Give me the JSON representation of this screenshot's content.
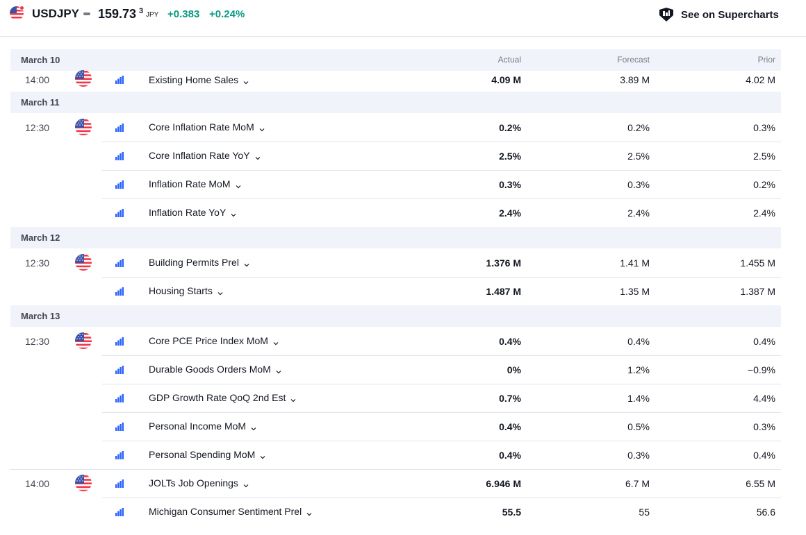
{
  "header": {
    "symbol": "USDJPY",
    "price": "159.73",
    "price_sup": "3",
    "currency": "JPY",
    "change_abs": "+0.383",
    "change_pct": "+0.24%",
    "supercharts_label": "See on Supercharts"
  },
  "columns": {
    "actual": "Actual",
    "forecast": "Forecast",
    "prior": "Prior"
  },
  "colors": {
    "positive": "#089981",
    "accent": "#2962ff",
    "flag_red": "#f23645"
  },
  "groups": [
    {
      "date": "March 10",
      "events": [
        {
          "time": "14:00",
          "name": "Existing Home Sales",
          "actual": "4.09 M",
          "forecast": "3.89 M",
          "prior": "4.02 M"
        }
      ]
    },
    {
      "date": "March 11",
      "events": [
        {
          "time": "12:30",
          "name": "Core Inflation Rate MoM",
          "actual": "0.2%",
          "forecast": "0.2%",
          "prior": "0.3%"
        },
        {
          "time": "",
          "name": "Core Inflation Rate YoY",
          "actual": "2.5%",
          "forecast": "2.5%",
          "prior": "2.5%"
        },
        {
          "time": "",
          "name": "Inflation Rate MoM",
          "actual": "0.3%",
          "forecast": "0.3%",
          "prior": "0.2%"
        },
        {
          "time": "",
          "name": "Inflation Rate YoY",
          "actual": "2.4%",
          "forecast": "2.4%",
          "prior": "2.4%"
        }
      ]
    },
    {
      "date": "March 12",
      "events": [
        {
          "time": "12:30",
          "name": "Building Permits Prel",
          "actual": "1.376 M",
          "forecast": "1.41 M",
          "prior": "1.455 M"
        },
        {
          "time": "",
          "name": "Housing Starts",
          "actual": "1.487 M",
          "forecast": "1.35 M",
          "prior": "1.387 M"
        }
      ]
    },
    {
      "date": "March 13",
      "events": [
        {
          "time": "12:30",
          "name": "Core PCE Price Index MoM",
          "actual": "0.4%",
          "forecast": "0.4%",
          "prior": "0.4%"
        },
        {
          "time": "",
          "name": "Durable Goods Orders MoM",
          "actual": "0%",
          "forecast": "1.2%",
          "prior": "−0.9%"
        },
        {
          "time": "",
          "name": "GDP Growth Rate QoQ 2nd Est",
          "actual": "0.7%",
          "forecast": "1.4%",
          "prior": "4.4%"
        },
        {
          "time": "",
          "name": "Personal Income MoM",
          "actual": "0.4%",
          "forecast": "0.5%",
          "prior": "0.3%"
        },
        {
          "time": "",
          "name": "Personal Spending MoM",
          "actual": "0.4%",
          "forecast": "0.3%",
          "prior": "0.4%"
        },
        {
          "time": "14:00",
          "name": "JOLTs Job Openings",
          "actual": "6.946 M",
          "forecast": "6.7 M",
          "prior": "6.55 M"
        },
        {
          "time": "",
          "name": "Michigan Consumer Sentiment Prel",
          "actual": "55.5",
          "forecast": "55",
          "prior": "56.6"
        }
      ]
    }
  ]
}
